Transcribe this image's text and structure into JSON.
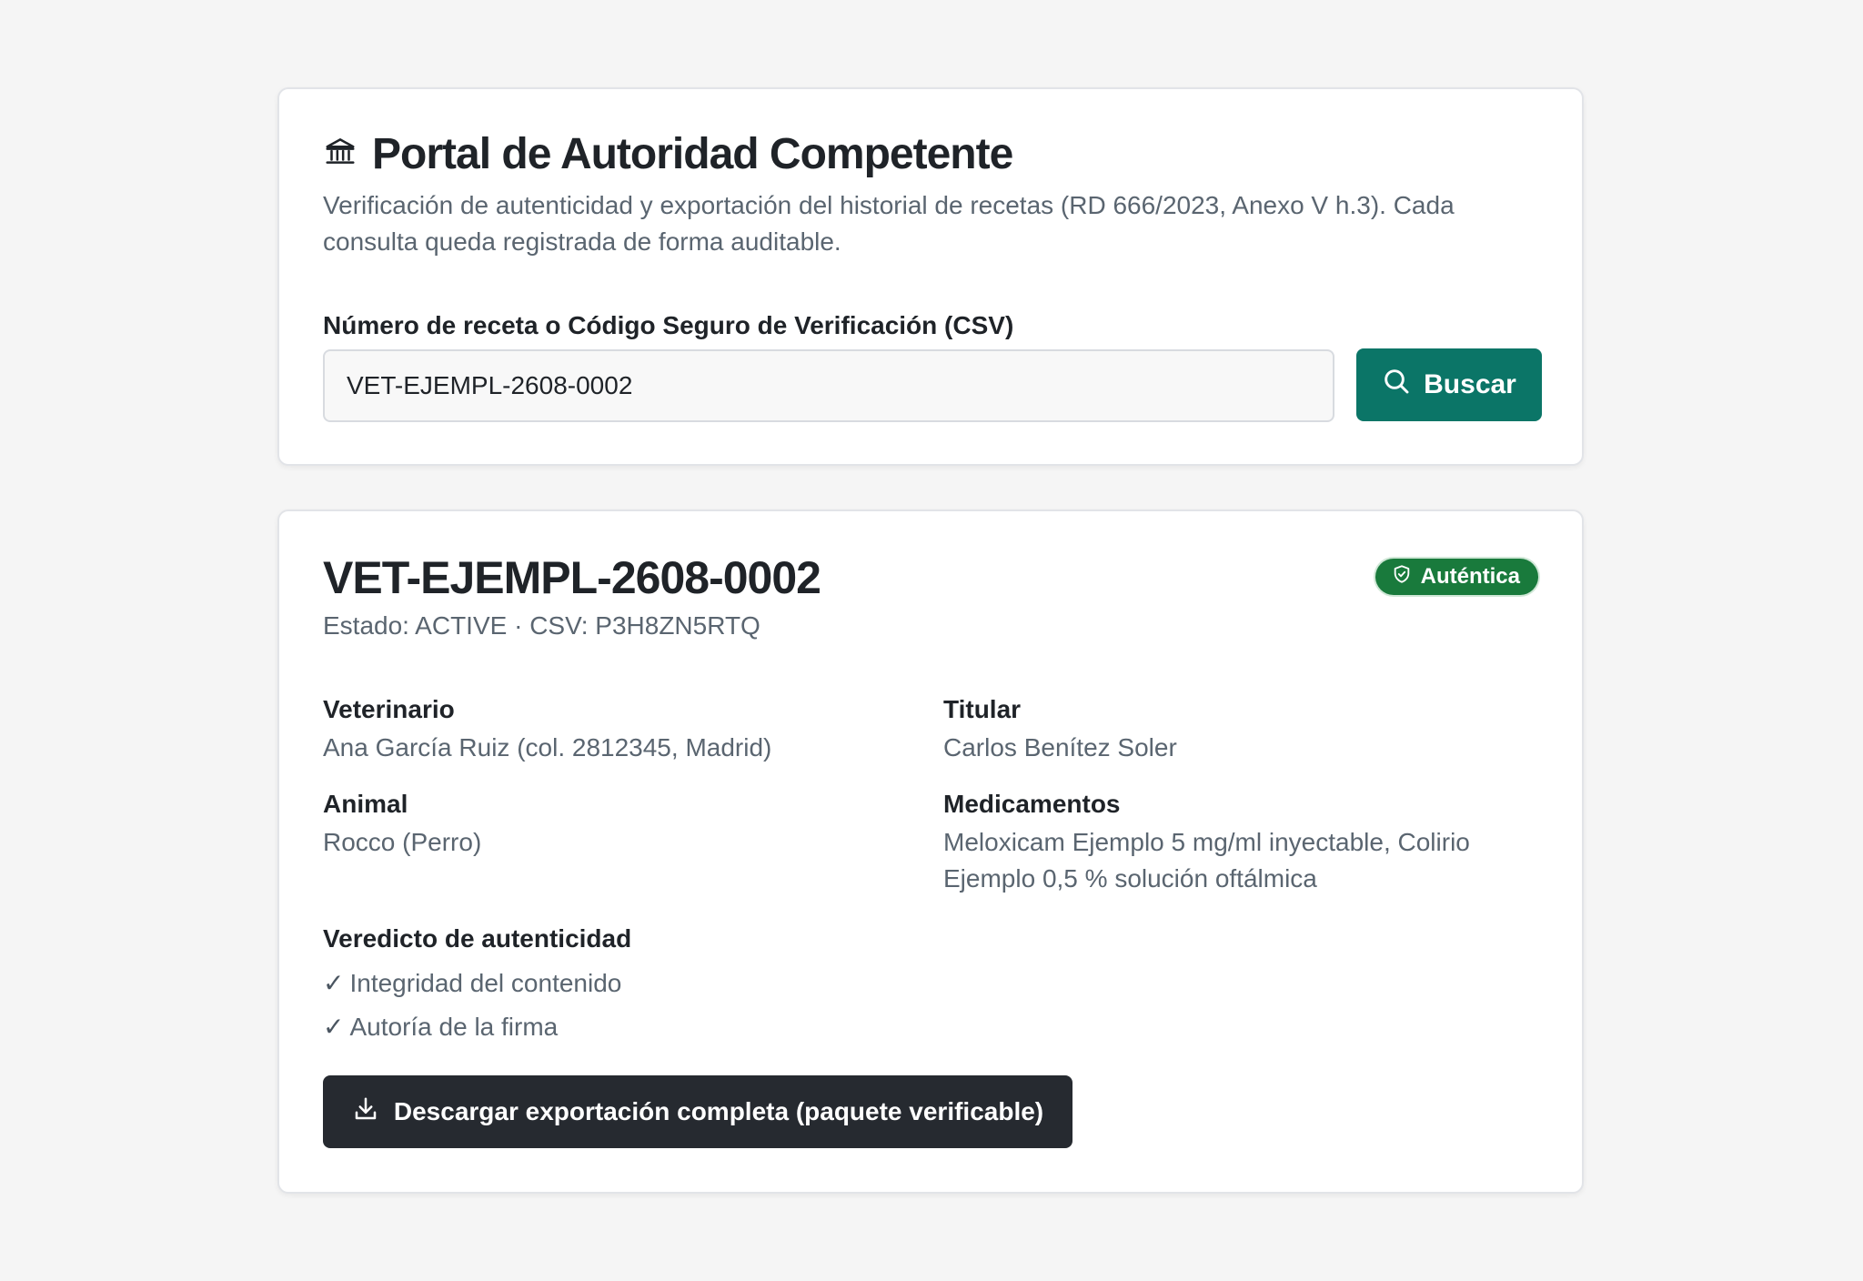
{
  "portal": {
    "title": "Portal de Autoridad Competente",
    "icon": "bank-icon",
    "description": "Verificación de autenticidad y exportación del historial de recetas (RD 666/2023, Anexo V h.3). Cada consulta queda registrada de forma auditable."
  },
  "search": {
    "label": "Número de receta o Código Seguro de Verificación (CSV)",
    "value": "VET-EJEMPL-2608-0002",
    "button_label": "Buscar",
    "button_icon": "search-icon"
  },
  "result": {
    "title": "VET-EJEMPL-2608-0002",
    "meta": "Estado: ACTIVE · CSV: P3H8ZN5RTQ",
    "badge": {
      "label": "Auténtica",
      "icon": "shield-check-icon",
      "color": "#197a3c"
    },
    "fields": {
      "veterinario": {
        "label": "Veterinario",
        "value": "Ana García Ruiz (col. 2812345, Madrid)"
      },
      "titular": {
        "label": "Titular",
        "value": "Carlos Benítez Soler"
      },
      "animal": {
        "label": "Animal",
        "value": "Rocco (Perro)"
      },
      "medicamentos": {
        "label": "Medicamentos",
        "value": "Meloxicam Ejemplo 5 mg/ml inyectable, Colirio Ejemplo 0,5 % solución oftálmica"
      }
    },
    "verdict": {
      "label": "Veredicto de autenticidad",
      "check_mark": "✓",
      "items": [
        "Integridad del contenido",
        "Autoría de la firma"
      ]
    },
    "download_label": "Descargar exportación completa (paquete verificable)",
    "download_icon": "download-icon"
  },
  "colors": {
    "primary": "#0b7567",
    "dark_button": "#262a30",
    "success": "#197a3c",
    "muted_text": "#5a6570"
  }
}
